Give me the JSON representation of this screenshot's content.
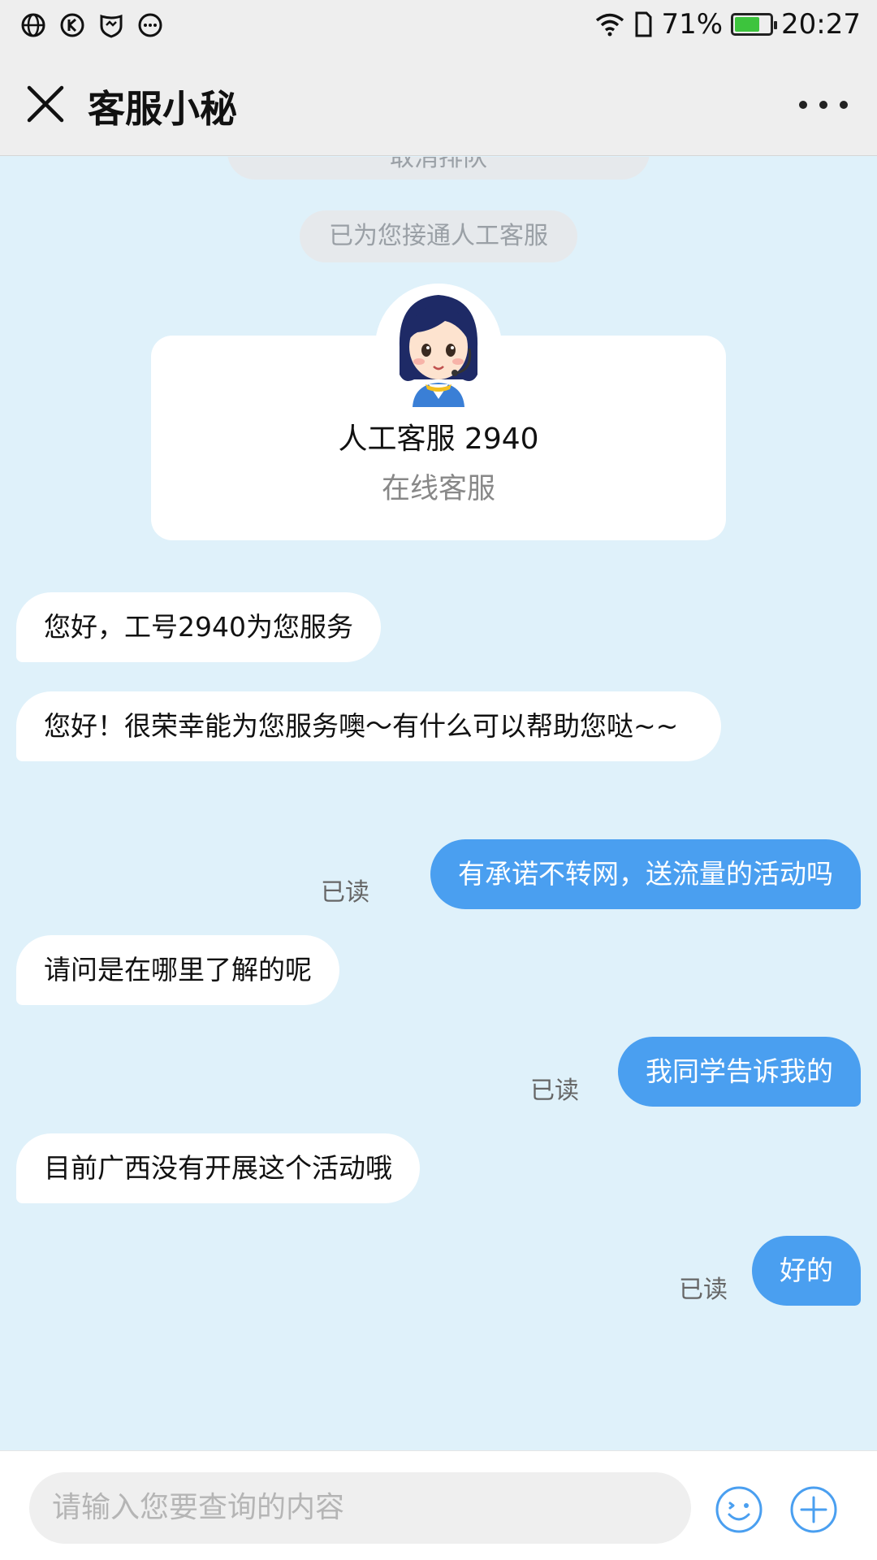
{
  "status_bar": {
    "battery": "71%",
    "battery_level": 0.71,
    "time": "20:27",
    "icons": [
      "globe-icon",
      "k-circle-icon",
      "shield-icon",
      "ellipsis-circle-icon",
      "wifi-icon",
      "sim-icon",
      "battery-icon"
    ]
  },
  "header": {
    "title": "客服小秘",
    "close_icon": "close-icon",
    "more_icon": "more-icon"
  },
  "chat": {
    "cancel_queue": "取消排队",
    "connected_notice": "已为您接通人工客服",
    "agent": {
      "name": "人工客服 2940",
      "role": "在线客服"
    },
    "messages": [
      {
        "from": "agent",
        "text": "您好，工号2940为您服务"
      },
      {
        "from": "agent",
        "text": "您好！很荣幸能为您服务噢～有什么可以帮助您哒~~"
      },
      {
        "from": "user",
        "text": "有承诺不转网，送流量的活动吗",
        "status": "已读"
      },
      {
        "from": "agent",
        "text": "请问是在哪里了解的呢"
      },
      {
        "from": "user",
        "text": "我同学告诉我的",
        "status": "已读"
      },
      {
        "from": "agent",
        "text": "目前广西没有开展这个活动哦"
      },
      {
        "from": "user",
        "text": "好的",
        "status": "已读"
      }
    ]
  },
  "input": {
    "placeholder": "请输入您要查询的内容",
    "emoji_icon": "emoji-icon",
    "plus_icon": "plus-icon"
  },
  "colors": {
    "chat_background": "#dff1fa",
    "user_bubble": "#4a9ff0",
    "agent_bubble": "#ffffff"
  }
}
